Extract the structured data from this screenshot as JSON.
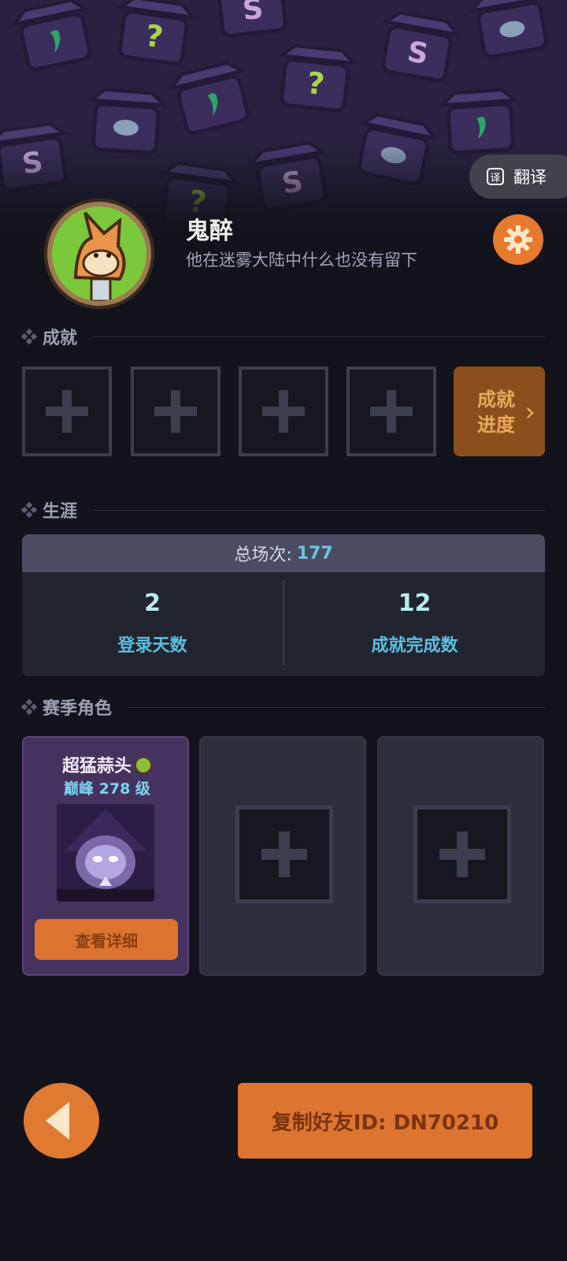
{
  "translate": {
    "label": "翻译",
    "icon": "translate-icon",
    "icon_glyph": "译"
  },
  "profile": {
    "name": "鬼醉",
    "bio": "他在迷雾大陆中什么也没有留下",
    "avatar_icon": "fox-avatar",
    "settings_icon": "gear-icon"
  },
  "achievements": {
    "title": "成就",
    "progress_label_line1": "成就",
    "progress_label_line2": "进度",
    "progress_arrow": "›"
  },
  "career": {
    "title": "生涯",
    "total_label": "总场次:",
    "total_value": "177",
    "stats": [
      {
        "value": "2",
        "label": "登录天数"
      },
      {
        "value": "12",
        "label": "成就完成数"
      }
    ]
  },
  "season": {
    "title": "赛季角色",
    "character": {
      "name": "超猛蒜头",
      "level": "巅峰 278 级",
      "detail_button": "查看详细"
    }
  },
  "bottom": {
    "copy_button": "复制好友ID: DN70210",
    "back_icon": "back-arrow-icon"
  },
  "colors": {
    "accent": "#e07a30",
    "background": "#12131b",
    "stat_value": "#b8ecec",
    "stat_label": "#5dbfe0"
  }
}
